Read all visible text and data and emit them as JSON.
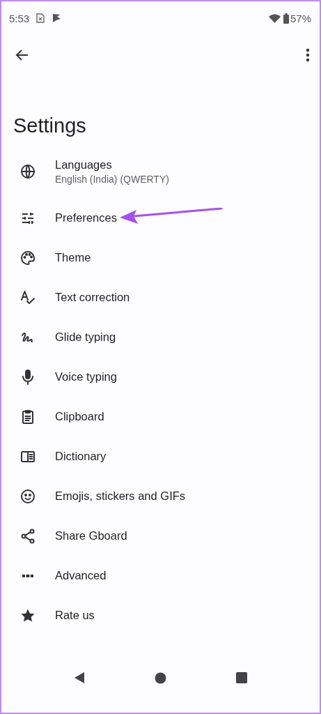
{
  "status_bar": {
    "time": "5:53",
    "battery": "57%"
  },
  "title": "Settings",
  "items": [
    {
      "label": "Languages",
      "subtitle": "English (India) (QWERTY)",
      "pointed": false
    },
    {
      "label": "Preferences",
      "pointed": true
    },
    {
      "label": "Theme",
      "pointed": false
    },
    {
      "label": "Text correction",
      "pointed": false
    },
    {
      "label": "Glide typing",
      "pointed": false
    },
    {
      "label": "Voice typing",
      "pointed": false
    },
    {
      "label": "Clipboard",
      "pointed": false
    },
    {
      "label": "Dictionary",
      "pointed": false
    },
    {
      "label": "Emojis, stickers and GIFs",
      "pointed": false
    },
    {
      "label": "Share Gboard",
      "pointed": false
    },
    {
      "label": "Advanced",
      "pointed": false
    },
    {
      "label": "Rate us",
      "pointed": false
    }
  ]
}
